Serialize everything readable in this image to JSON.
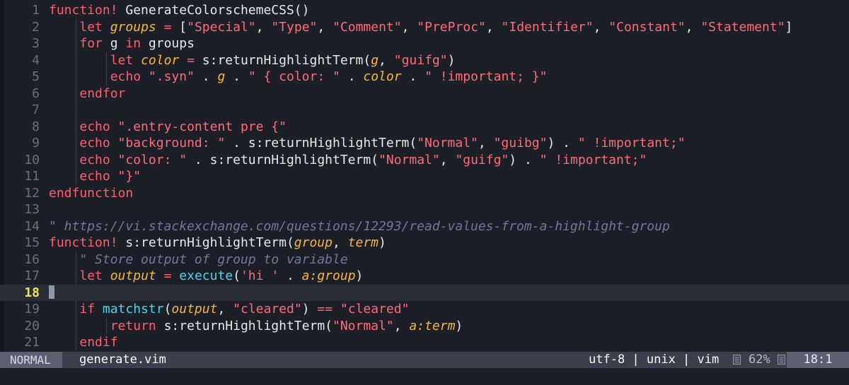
{
  "editor": {
    "lines": [
      {
        "n": "1",
        "tokens": [
          [
            "kw",
            "function!"
          ],
          [
            "pl",
            " GenerateColorschemeCSS()"
          ]
        ]
      },
      {
        "n": "2",
        "indent": 1,
        "tokens": [
          [
            "kw",
            "let "
          ],
          [
            "var",
            "groups"
          ],
          [
            "op",
            " = "
          ],
          [
            "pl",
            "["
          ],
          [
            "str",
            "\"Special\""
          ],
          [
            "pl",
            ", "
          ],
          [
            "str",
            "\"Type\""
          ],
          [
            "pl",
            ", "
          ],
          [
            "str",
            "\"Comment\""
          ],
          [
            "pl",
            ", "
          ],
          [
            "str",
            "\"PreProc\""
          ],
          [
            "pl",
            ", "
          ],
          [
            "str",
            "\"Identifier\""
          ],
          [
            "pl",
            ", "
          ],
          [
            "str",
            "\"Constant\""
          ],
          [
            "pl",
            ", "
          ],
          [
            "str",
            "\"Statement\""
          ],
          [
            "pl",
            "]"
          ]
        ]
      },
      {
        "n": "3",
        "indent": 1,
        "tokens": [
          [
            "kw",
            "for "
          ],
          [
            "pl",
            "g "
          ],
          [
            "kw",
            "in "
          ],
          [
            "pl",
            "groups"
          ]
        ]
      },
      {
        "n": "4",
        "indent": 2,
        "tokens": [
          [
            "kw",
            "let "
          ],
          [
            "var",
            "color"
          ],
          [
            "op",
            " = "
          ],
          [
            "pl",
            "s:returnHighlightTerm("
          ],
          [
            "var",
            "g"
          ],
          [
            "pl",
            ", "
          ],
          [
            "str",
            "\"guifg\""
          ],
          [
            "pl",
            ")"
          ]
        ]
      },
      {
        "n": "5",
        "indent": 2,
        "tokens": [
          [
            "kw",
            "echo "
          ],
          [
            "str",
            "\".syn\""
          ],
          [
            "pl",
            " . "
          ],
          [
            "var",
            "g"
          ],
          [
            "pl",
            " . "
          ],
          [
            "str",
            "\" { color: \""
          ],
          [
            "pl",
            " . "
          ],
          [
            "var",
            "color"
          ],
          [
            "pl",
            " . "
          ],
          [
            "str",
            "\" !important; }\""
          ]
        ]
      },
      {
        "n": "6",
        "indent": 1,
        "tokens": [
          [
            "kw",
            "endfor"
          ]
        ]
      },
      {
        "n": "7",
        "indent": 1,
        "tokens": []
      },
      {
        "n": "8",
        "indent": 1,
        "tokens": [
          [
            "kw",
            "echo "
          ],
          [
            "str",
            "\".entry-content pre {\""
          ]
        ]
      },
      {
        "n": "9",
        "indent": 1,
        "tokens": [
          [
            "kw",
            "echo "
          ],
          [
            "str",
            "\"background: \""
          ],
          [
            "pl",
            " . s:returnHighlightTerm("
          ],
          [
            "str",
            "\"Normal\""
          ],
          [
            "pl",
            ", "
          ],
          [
            "str",
            "\"guibg\""
          ],
          [
            "pl",
            ") . "
          ],
          [
            "str",
            "\" !important;\""
          ]
        ]
      },
      {
        "n": "10",
        "indent": 1,
        "tokens": [
          [
            "kw",
            "echo "
          ],
          [
            "str",
            "\"color: \""
          ],
          [
            "pl",
            " . s:returnHighlightTerm("
          ],
          [
            "str",
            "\"Normal\""
          ],
          [
            "pl",
            ", "
          ],
          [
            "str",
            "\"guifg\""
          ],
          [
            "pl",
            ") . "
          ],
          [
            "str",
            "\" !important;\""
          ]
        ]
      },
      {
        "n": "11",
        "indent": 1,
        "tokens": [
          [
            "kw",
            "echo "
          ],
          [
            "str",
            "\"}\""
          ]
        ]
      },
      {
        "n": "12",
        "tokens": [
          [
            "kw",
            "endfunction"
          ]
        ]
      },
      {
        "n": "13",
        "tokens": []
      },
      {
        "n": "14",
        "tokens": [
          [
            "cm",
            "\" https://vi.stackexchange.com/questions/12293/read-values-from-a-highlight-group"
          ]
        ]
      },
      {
        "n": "15",
        "tokens": [
          [
            "kw",
            "function!"
          ],
          [
            "pl",
            " s:returnHighlightTerm("
          ],
          [
            "var",
            "group"
          ],
          [
            "pl",
            ", "
          ],
          [
            "var",
            "term"
          ],
          [
            "pl",
            ")"
          ]
        ]
      },
      {
        "n": "16",
        "indent": 1,
        "tokens": [
          [
            "cm",
            "\" Store output of group to variable"
          ]
        ]
      },
      {
        "n": "17",
        "indent": 1,
        "tokens": [
          [
            "kw",
            "let "
          ],
          [
            "var",
            "output"
          ],
          [
            "op",
            " = "
          ],
          [
            "bi",
            "execute"
          ],
          [
            "pl",
            "("
          ],
          [
            "str",
            "'hi '"
          ],
          [
            "pl",
            " . "
          ],
          [
            "var",
            "a:group"
          ],
          [
            "pl",
            ")"
          ]
        ]
      },
      {
        "n": "18",
        "current": true,
        "tokens": []
      },
      {
        "n": "19",
        "indent": 1,
        "tokens": [
          [
            "kw",
            "if "
          ],
          [
            "bi",
            "matchstr"
          ],
          [
            "pl",
            "("
          ],
          [
            "var",
            "output"
          ],
          [
            "pl",
            ", "
          ],
          [
            "str",
            "\"cleared\""
          ],
          [
            "pl",
            ") "
          ],
          [
            "op",
            "=="
          ],
          [
            "pl",
            " "
          ],
          [
            "str",
            "\"cleared\""
          ]
        ]
      },
      {
        "n": "20",
        "indent": 2,
        "tokens": [
          [
            "kw",
            "return "
          ],
          [
            "pl",
            "s:returnHighlightTerm("
          ],
          [
            "str",
            "\"Normal\""
          ],
          [
            "pl",
            ", "
          ],
          [
            "var",
            "a:term"
          ],
          [
            "pl",
            ")"
          ]
        ]
      },
      {
        "n": "21",
        "indent": 1,
        "tokens": [
          [
            "kw",
            "endif"
          ]
        ]
      }
    ]
  },
  "statusbar": {
    "mode": "NORMAL",
    "filename": "generate.vim",
    "encoding": "utf-8 | unix | vim",
    "percent": "62%",
    "position": "18:1",
    "icons": [
      "file-icon",
      "file-icon"
    ]
  },
  "colors": {
    "background": "#1c1f27",
    "keyword": "#ff5f6d",
    "string": "#ff6b78",
    "variable": "#f4b73a",
    "builtin": "#4fd3e6",
    "comment": "#6d7a9c",
    "statusbar": "#3a3f4b"
  }
}
